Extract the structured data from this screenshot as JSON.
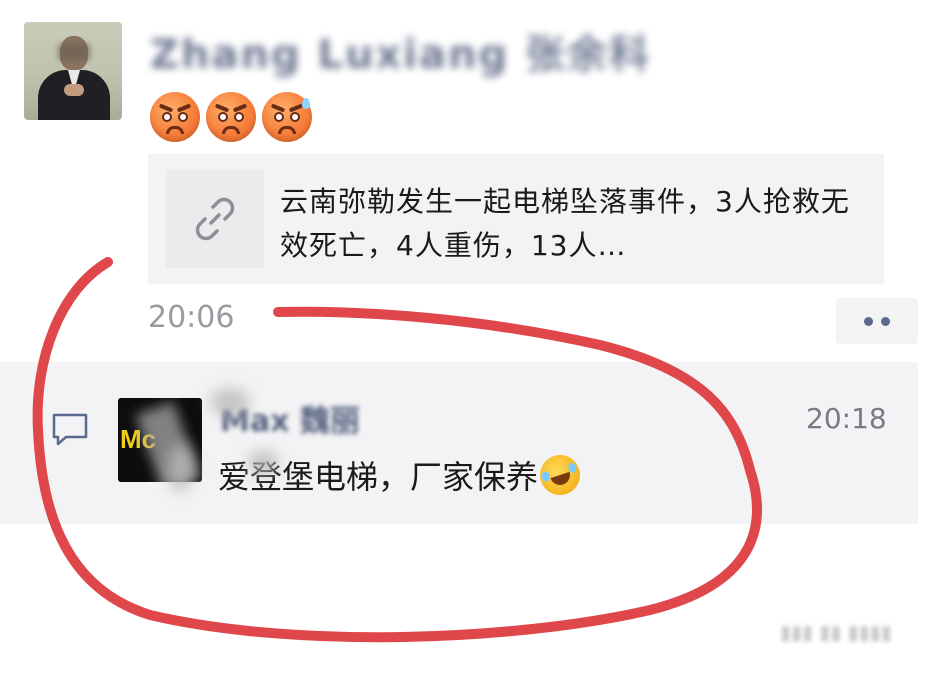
{
  "post": {
    "author_name": "Zhang Luxiang 张余科",
    "emojis": [
      {
        "icon": "worried-face-emoji"
      },
      {
        "icon": "worried-face-emoji"
      },
      {
        "icon": "worried-sweat-face-emoji"
      }
    ],
    "link": {
      "icon": "link-icon",
      "title": "云南弥勒发生一起电梯坠落事件，3人抢救无效死亡，4人重伤，13人…"
    },
    "time": "20:06"
  },
  "comment": {
    "commenter_name": "Max 魏丽",
    "avatar_logo": "Mc",
    "time": "20:18",
    "text": "爱登堡电梯，厂家保养",
    "emoji": "face-with-tears-of-joy-emoji"
  },
  "colors": {
    "name_link_color": "#55617f",
    "card_background": "#f3f3f5",
    "annotation_circle": "#e0474a"
  }
}
